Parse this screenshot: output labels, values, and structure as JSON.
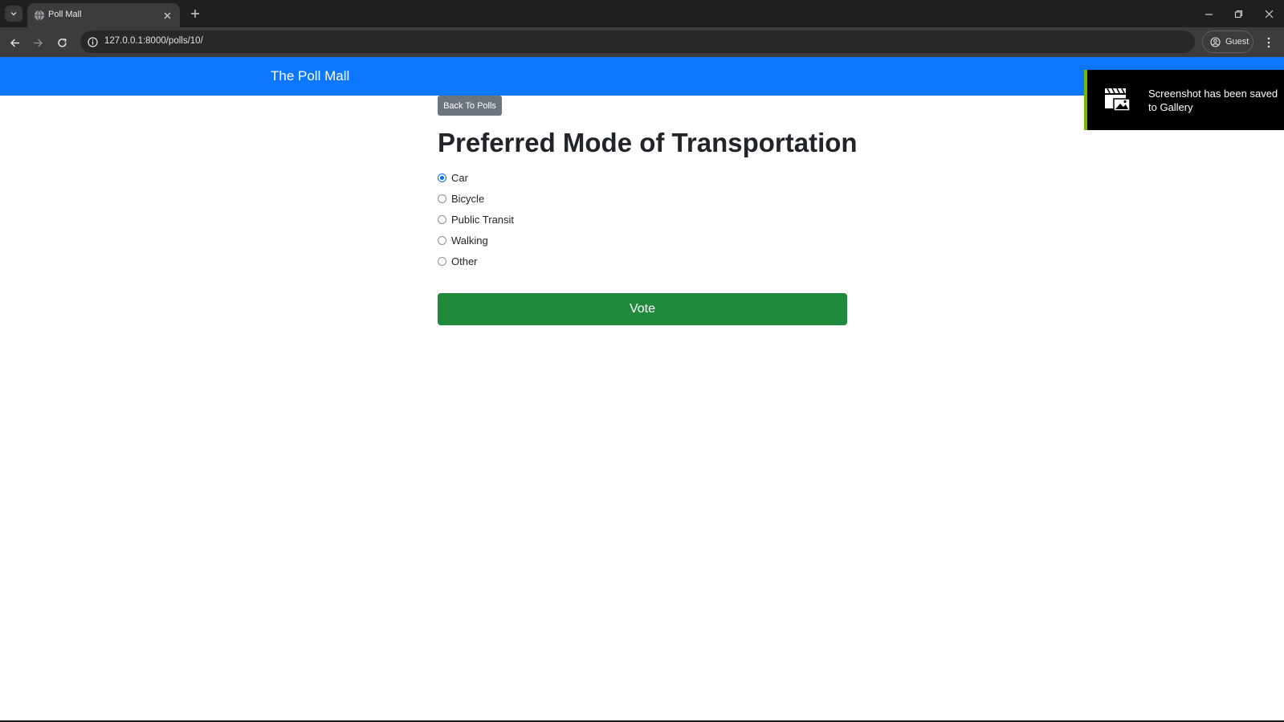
{
  "browser": {
    "tab_title": "Poll Mall",
    "url": "127.0.0.1:8000/polls/10/",
    "profile_label": "Guest"
  },
  "navbar": {
    "brand": "The Poll Mall"
  },
  "poll": {
    "back_label": "Back To Polls",
    "question": "Preferred Mode of Transportation",
    "choices": [
      {
        "label": "Car",
        "checked": true
      },
      {
        "label": "Bicycle",
        "checked": false
      },
      {
        "label": "Public Transit",
        "checked": false
      },
      {
        "label": "Walking",
        "checked": false
      },
      {
        "label": "Other",
        "checked": false
      }
    ],
    "vote_label": "Vote"
  },
  "toast": {
    "message": "Screenshot has been saved to Gallery"
  },
  "colors": {
    "navbar": "#0d78ff",
    "vote_button": "#1f8a3b",
    "back_button": "#6c757d",
    "toast_accent": "#76b900"
  }
}
